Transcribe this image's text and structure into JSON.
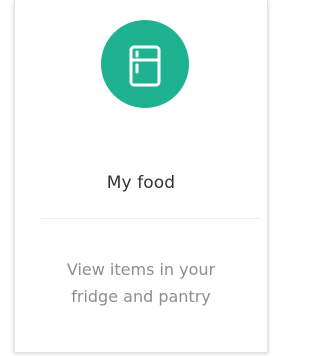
{
  "card": {
    "title": "My food",
    "description_line1": "View items in your",
    "description_line2": "fridge and pantry",
    "icon": "fridge-icon",
    "accent_color": "#1fb291"
  }
}
